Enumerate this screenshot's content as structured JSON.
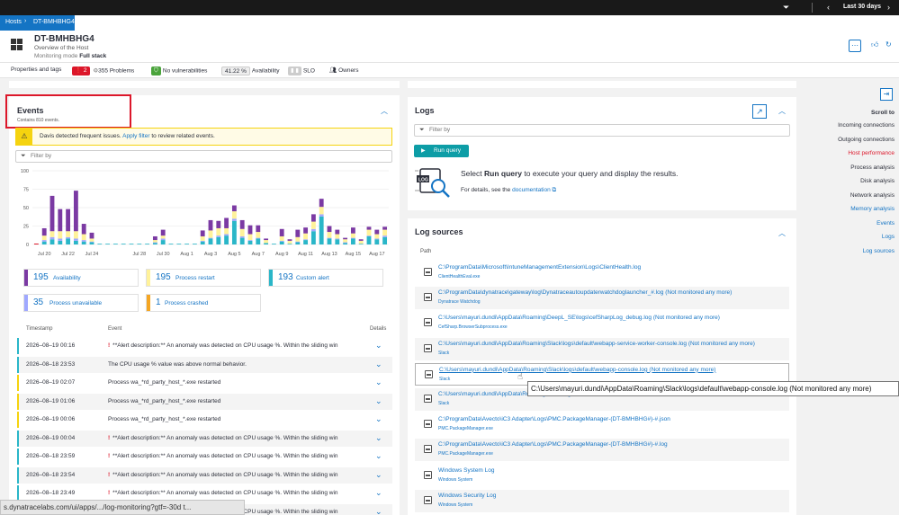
{
  "topbar": {
    "timeframe": "Last 30 days"
  },
  "breadcrumb": {
    "root": "Hosts",
    "current": "DT-BMHBHG4"
  },
  "host": {
    "name": "DT-BMHBHG4",
    "subtitle": "Overview of the Host",
    "mode_label": "Monitoring mode",
    "mode_value": "Full stack"
  },
  "statusbar": {
    "properties": "Properties and tags",
    "problems_count": "2",
    "problems_total": "355",
    "problems_label": "Problems",
    "vulnerabilities": "No vulnerabilities",
    "availability_value": "41.22 %",
    "availability_label": "Availability",
    "slo_label": "SLO",
    "owners": "Owners"
  },
  "events": {
    "title": "Events",
    "subtitle": "Contains 810 events.",
    "warning_text": "Davis detected frequent issues.",
    "warning_link": "Apply filter",
    "warning_suffix": "to review related events.",
    "filter_placeholder": "Filter by",
    "tiles": [
      {
        "count": "195",
        "label": "Availability",
        "color": "#7b3aa3"
      },
      {
        "count": "195",
        "label": "Process restart",
        "color": "#fff29a"
      },
      {
        "count": "193",
        "label": "Custom alert",
        "color": "#2ab6c8"
      },
      {
        "count": "35",
        "label": "Process unavailable",
        "color": "#9fa8ff"
      },
      {
        "count": "1",
        "label": "Process crashed",
        "color": "#f5a623"
      }
    ],
    "columns": {
      "timestamp": "Timestamp",
      "event": "Event",
      "details": "Details"
    },
    "rows": [
      {
        "ts": "2026–08–19 00:16",
        "alert": true,
        "text": "**Alert description:** An anomaly was detected on CPU usage %. Within the sliding win",
        "color": "#2ab6c8"
      },
      {
        "ts": "2026–08–18 23:53",
        "alert": false,
        "text": "The CPU usage % value was above normal behavior.",
        "color": "#2ab6c8"
      },
      {
        "ts": "2026–08–19 02:07",
        "alert": false,
        "text": "Process wa_*rd_party_host_*.exe restarted",
        "color": "#f5d30f"
      },
      {
        "ts": "2026–08–19 01:06",
        "alert": false,
        "text": "Process wa_*rd_party_host_*.exe restarted",
        "color": "#f5d30f"
      },
      {
        "ts": "2026–08–19 00:06",
        "alert": false,
        "text": "Process wa_*rd_party_host_*.exe restarted",
        "color": "#f5d30f"
      },
      {
        "ts": "2026–08–19 00:04",
        "alert": true,
        "text": "**Alert description:** An anomaly was detected on CPU usage %. Within the sliding win",
        "color": "#2ab6c8"
      },
      {
        "ts": "2026–08–18 23:59",
        "alert": true,
        "text": "**Alert description:** An anomaly was detected on CPU usage %. Within the sliding win",
        "color": "#2ab6c8"
      },
      {
        "ts": "2026–08–18 23:54",
        "alert": true,
        "text": "**Alert description:** An anomaly was detected on CPU usage %. Within the sliding win",
        "color": "#2ab6c8"
      },
      {
        "ts": "2026–08–18 23:49",
        "alert": true,
        "text": "**Alert description:** An anomaly was detected on CPU usage %. Within the sliding win",
        "color": "#2ab6c8"
      },
      {
        "ts": "",
        "alert": true,
        "text": "**Alert description:** An anomaly was detected on CPU usage %. Within the sliding win",
        "color": "#2ab6c8"
      }
    ]
  },
  "chart_data": {
    "type": "bar",
    "stacked": true,
    "ylim": [
      0,
      100
    ],
    "yticks": [
      0,
      25,
      50,
      75,
      100
    ],
    "x_tick_labels": [
      "Jul 20",
      "Jul 22",
      "Jul 24",
      "Jul 28",
      "Jul 30",
      "Aug 1",
      "Aug 3",
      "Aug 5",
      "Aug 7",
      "Aug 9",
      "Aug 11",
      "Aug 13",
      "Aug 15",
      "Aug 17"
    ],
    "x_tick_index": [
      1,
      4,
      7,
      13,
      16,
      19,
      22,
      25,
      28,
      31,
      34,
      37,
      40,
      43
    ],
    "series": [
      {
        "color": "#2ab6c8",
        "values": [
          0,
          4,
          7,
          5,
          8,
          5,
          4,
          3,
          1,
          1,
          1,
          1,
          1,
          1,
          1,
          2,
          6,
          1,
          1,
          1,
          1,
          4,
          8,
          10,
          12,
          32,
          9,
          5,
          8,
          2,
          1,
          4,
          1,
          3,
          6,
          18,
          38,
          8,
          7,
          2,
          8,
          1,
          11,
          7,
          10
        ]
      },
      {
        "color": "#9fa8ff",
        "values": [
          0,
          2,
          3,
          3,
          2,
          3,
          2,
          1,
          0,
          0,
          0,
          0,
          0,
          0,
          0,
          1,
          2,
          0,
          0,
          0,
          0,
          1,
          1,
          2,
          2,
          3,
          2,
          1,
          1,
          0,
          0,
          1,
          0,
          1,
          1,
          3,
          3,
          1,
          1,
          1,
          1,
          0,
          1,
          1,
          2
        ]
      },
      {
        "color": "#fff29a",
        "values": [
          0,
          6,
          8,
          10,
          8,
          10,
          8,
          4,
          0,
          0,
          0,
          0,
          0,
          0,
          0,
          3,
          4,
          0,
          0,
          0,
          0,
          6,
          10,
          10,
          8,
          10,
          10,
          8,
          8,
          4,
          0,
          6,
          4,
          6,
          8,
          10,
          10,
          8,
          6,
          4,
          6,
          4,
          8,
          6,
          8
        ]
      },
      {
        "color": "#7b3aa3",
        "values": [
          0,
          10,
          48,
          30,
          30,
          55,
          14,
          8,
          0,
          0,
          0,
          0,
          0,
          0,
          0,
          5,
          8,
          0,
          0,
          0,
          0,
          8,
          14,
          10,
          14,
          8,
          12,
          12,
          9,
          2,
          0,
          10,
          2,
          10,
          8,
          10,
          11,
          8,
          6,
          2,
          8,
          2,
          4,
          6,
          4
        ]
      },
      {
        "color": "#f5a623",
        "values": [
          0,
          0,
          0,
          0,
          0,
          0,
          0,
          0,
          0,
          0,
          0,
          0,
          0,
          0,
          0,
          0,
          0,
          0,
          0,
          0,
          0,
          0,
          0,
          0,
          0,
          0,
          0,
          0,
          0,
          0,
          0,
          0,
          0,
          0,
          0,
          0,
          0,
          0,
          0,
          0,
          0,
          0,
          0,
          0,
          0
        ]
      }
    ]
  },
  "logs": {
    "title": "Logs",
    "filter_placeholder": "Filter by",
    "run_query": "Run query",
    "select_text_pre": "Select",
    "select_text_bold": "Run query",
    "select_text_post": "to execute your query and display the results.",
    "details_pre": "For details, see the",
    "details_link": "documentation"
  },
  "log_sources": {
    "title": "Log sources",
    "path_header": "Path",
    "rows": [
      {
        "path": "C:\\ProgramData\\Microsoft\\IntuneManagementExtension\\Logs\\ClientHealth.log",
        "source": "ClientHealthEval.exe"
      },
      {
        "path": "C:\\ProgramData\\dynatrace\\gateway\\log\\Dynatraceautoupdaterwatchdoglauncher_#.log (Not monitored any more)",
        "source": "Dynatrace Watchdog"
      },
      {
        "path": "C:\\Users\\mayuri.dundi\\AppData\\Roaming\\DeepL_SE\\logs\\cefSharpLog_debug.log (Not monitored any more)",
        "source": "CefSharp.BrowserSubprocess.exe"
      },
      {
        "path": "C:\\Users\\mayuri.dundi\\AppData\\Roaming\\Slack\\logs\\default\\webapp-service-worker-console.log (Not monitored any more)",
        "source": "Slack"
      },
      {
        "path": "C:\\Users\\mayuri.dundi\\AppData\\Roaming\\Slack\\logs\\default\\webapp-console.log (Not monitored any more)",
        "source": "Slack"
      },
      {
        "path": "C:\\Users\\mayuri.dundi\\AppData\\Roaming\\Slack\\logs\\default\\",
        "source": "Slack"
      },
      {
        "path": "C:\\ProgramData\\Avecto\\iC3 Adapter\\Logs\\PMC.PackageManager-(DT-BMHBHG#)-#.json",
        "source": "PMC.PackageManager.exe"
      },
      {
        "path": "C:\\ProgramData\\Avecto\\iC3 Adapter\\Logs\\PMC.PackageManager-(DT-BMHBHG#)-#.log",
        "source": "PMC.PackageManager.exe"
      },
      {
        "path": "Windows System Log",
        "source": "Windows System"
      },
      {
        "path": "Windows Security Log",
        "source": "Windows System"
      }
    ],
    "tooltip": "C:\\Users\\mayuri.dundi\\AppData\\Roaming\\Slack\\logs\\default\\webapp-console.log (Not monitored any more)"
  },
  "scroll_to": {
    "title": "Scroll to",
    "items": [
      {
        "label": "Incoming connections",
        "color": "#2c2f3a"
      },
      {
        "label": "Outgoing connections",
        "color": "#2c2f3a"
      },
      {
        "label": "Host performance",
        "color": "#dc172a"
      },
      {
        "label": "Process analysis",
        "color": "#2c2f3a"
      },
      {
        "label": "Disk analysis",
        "color": "#2c2f3a"
      },
      {
        "label": "Network analysis",
        "color": "#2c2f3a"
      },
      {
        "label": "Memory analysis",
        "color": "#1474c4"
      },
      {
        "label": "Events",
        "color": "#1474c4"
      },
      {
        "label": "Logs",
        "color": "#1474c4"
      },
      {
        "label": "Log sources",
        "color": "#1474c4"
      }
    ]
  },
  "status_url": "s.dynatracelabs.com/ui/apps/.../log-monitoring?gtf=-30d t..."
}
